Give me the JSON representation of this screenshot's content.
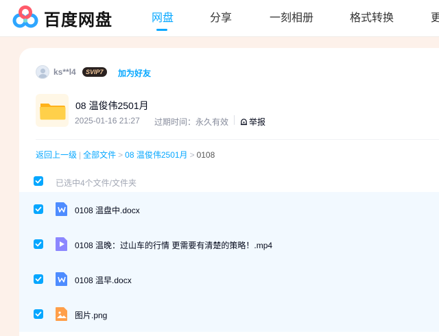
{
  "header": {
    "brand": "百度网盘",
    "nav": [
      "网盘",
      "分享",
      "一刻相册",
      "格式转换",
      "更"
    ],
    "active_index": 0
  },
  "user": {
    "name": "ks**l4",
    "vip_badge": "SVIP7",
    "add_friend": "加为好友"
  },
  "share": {
    "folder_title": "08 温俊伟2501月",
    "date": "2025-01-16 21:27",
    "expiry_label": "过期时间：永久有效",
    "report_label": "举报"
  },
  "breadcrumb": {
    "back": "返回上一级",
    "all": "全部文件",
    "folder": "08 温俊伟2501月",
    "current": "0108"
  },
  "selection": {
    "text": "已选中4个文件/文件夹"
  },
  "files": [
    {
      "name": "0108 温盘中.docx",
      "type": "word"
    },
    {
      "name": "0108 温晚：过山车的行情 更需要有清楚的策略！.mp4",
      "type": "video"
    },
    {
      "name": "0108 温早.docx",
      "type": "word"
    },
    {
      "name": "图片.png",
      "type": "image"
    }
  ],
  "colors": {
    "accent": "#06a7ff",
    "background": "#fdf1ea",
    "row_selected": "#f2f9ff",
    "word_icon": "#4e8cff",
    "video_icon": "#8c87ff",
    "image_icon": "#ff9f4a",
    "folder": "#ffc53d"
  }
}
